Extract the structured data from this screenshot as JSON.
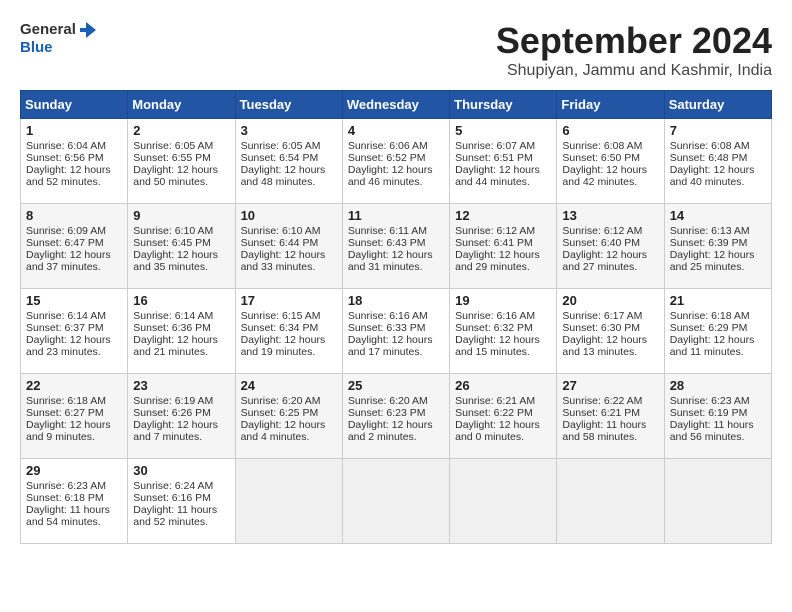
{
  "header": {
    "logo_general": "General",
    "logo_blue": "Blue",
    "month_year": "September 2024",
    "location": "Shupiyan, Jammu and Kashmir, India"
  },
  "days_of_week": [
    "Sunday",
    "Monday",
    "Tuesday",
    "Wednesday",
    "Thursday",
    "Friday",
    "Saturday"
  ],
  "calendar": [
    [
      {
        "day": "1",
        "sunrise": "Sunrise: 6:04 AM",
        "sunset": "Sunset: 6:56 PM",
        "daylight": "Daylight: 12 hours and 52 minutes."
      },
      {
        "day": "2",
        "sunrise": "Sunrise: 6:05 AM",
        "sunset": "Sunset: 6:55 PM",
        "daylight": "Daylight: 12 hours and 50 minutes."
      },
      {
        "day": "3",
        "sunrise": "Sunrise: 6:05 AM",
        "sunset": "Sunset: 6:54 PM",
        "daylight": "Daylight: 12 hours and 48 minutes."
      },
      {
        "day": "4",
        "sunrise": "Sunrise: 6:06 AM",
        "sunset": "Sunset: 6:52 PM",
        "daylight": "Daylight: 12 hours and 46 minutes."
      },
      {
        "day": "5",
        "sunrise": "Sunrise: 6:07 AM",
        "sunset": "Sunset: 6:51 PM",
        "daylight": "Daylight: 12 hours and 44 minutes."
      },
      {
        "day": "6",
        "sunrise": "Sunrise: 6:08 AM",
        "sunset": "Sunset: 6:50 PM",
        "daylight": "Daylight: 12 hours and 42 minutes."
      },
      {
        "day": "7",
        "sunrise": "Sunrise: 6:08 AM",
        "sunset": "Sunset: 6:48 PM",
        "daylight": "Daylight: 12 hours and 40 minutes."
      }
    ],
    [
      {
        "day": "8",
        "sunrise": "Sunrise: 6:09 AM",
        "sunset": "Sunset: 6:47 PM",
        "daylight": "Daylight: 12 hours and 37 minutes."
      },
      {
        "day": "9",
        "sunrise": "Sunrise: 6:10 AM",
        "sunset": "Sunset: 6:45 PM",
        "daylight": "Daylight: 12 hours and 35 minutes."
      },
      {
        "day": "10",
        "sunrise": "Sunrise: 6:10 AM",
        "sunset": "Sunset: 6:44 PM",
        "daylight": "Daylight: 12 hours and 33 minutes."
      },
      {
        "day": "11",
        "sunrise": "Sunrise: 6:11 AM",
        "sunset": "Sunset: 6:43 PM",
        "daylight": "Daylight: 12 hours and 31 minutes."
      },
      {
        "day": "12",
        "sunrise": "Sunrise: 6:12 AM",
        "sunset": "Sunset: 6:41 PM",
        "daylight": "Daylight: 12 hours and 29 minutes."
      },
      {
        "day": "13",
        "sunrise": "Sunrise: 6:12 AM",
        "sunset": "Sunset: 6:40 PM",
        "daylight": "Daylight: 12 hours and 27 minutes."
      },
      {
        "day": "14",
        "sunrise": "Sunrise: 6:13 AM",
        "sunset": "Sunset: 6:39 PM",
        "daylight": "Daylight: 12 hours and 25 minutes."
      }
    ],
    [
      {
        "day": "15",
        "sunrise": "Sunrise: 6:14 AM",
        "sunset": "Sunset: 6:37 PM",
        "daylight": "Daylight: 12 hours and 23 minutes."
      },
      {
        "day": "16",
        "sunrise": "Sunrise: 6:14 AM",
        "sunset": "Sunset: 6:36 PM",
        "daylight": "Daylight: 12 hours and 21 minutes."
      },
      {
        "day": "17",
        "sunrise": "Sunrise: 6:15 AM",
        "sunset": "Sunset: 6:34 PM",
        "daylight": "Daylight: 12 hours and 19 minutes."
      },
      {
        "day": "18",
        "sunrise": "Sunrise: 6:16 AM",
        "sunset": "Sunset: 6:33 PM",
        "daylight": "Daylight: 12 hours and 17 minutes."
      },
      {
        "day": "19",
        "sunrise": "Sunrise: 6:16 AM",
        "sunset": "Sunset: 6:32 PM",
        "daylight": "Daylight: 12 hours and 15 minutes."
      },
      {
        "day": "20",
        "sunrise": "Sunrise: 6:17 AM",
        "sunset": "Sunset: 6:30 PM",
        "daylight": "Daylight: 12 hours and 13 minutes."
      },
      {
        "day": "21",
        "sunrise": "Sunrise: 6:18 AM",
        "sunset": "Sunset: 6:29 PM",
        "daylight": "Daylight: 12 hours and 11 minutes."
      }
    ],
    [
      {
        "day": "22",
        "sunrise": "Sunrise: 6:18 AM",
        "sunset": "Sunset: 6:27 PM",
        "daylight": "Daylight: 12 hours and 9 minutes."
      },
      {
        "day": "23",
        "sunrise": "Sunrise: 6:19 AM",
        "sunset": "Sunset: 6:26 PM",
        "daylight": "Daylight: 12 hours and 7 minutes."
      },
      {
        "day": "24",
        "sunrise": "Sunrise: 6:20 AM",
        "sunset": "Sunset: 6:25 PM",
        "daylight": "Daylight: 12 hours and 4 minutes."
      },
      {
        "day": "25",
        "sunrise": "Sunrise: 6:20 AM",
        "sunset": "Sunset: 6:23 PM",
        "daylight": "Daylight: 12 hours and 2 minutes."
      },
      {
        "day": "26",
        "sunrise": "Sunrise: 6:21 AM",
        "sunset": "Sunset: 6:22 PM",
        "daylight": "Daylight: 12 hours and 0 minutes."
      },
      {
        "day": "27",
        "sunrise": "Sunrise: 6:22 AM",
        "sunset": "Sunset: 6:21 PM",
        "daylight": "Daylight: 11 hours and 58 minutes."
      },
      {
        "day": "28",
        "sunrise": "Sunrise: 6:23 AM",
        "sunset": "Sunset: 6:19 PM",
        "daylight": "Daylight: 11 hours and 56 minutes."
      }
    ],
    [
      {
        "day": "29",
        "sunrise": "Sunrise: 6:23 AM",
        "sunset": "Sunset: 6:18 PM",
        "daylight": "Daylight: 11 hours and 54 minutes."
      },
      {
        "day": "30",
        "sunrise": "Sunrise: 6:24 AM",
        "sunset": "Sunset: 6:16 PM",
        "daylight": "Daylight: 11 hours and 52 minutes."
      },
      null,
      null,
      null,
      null,
      null
    ]
  ]
}
